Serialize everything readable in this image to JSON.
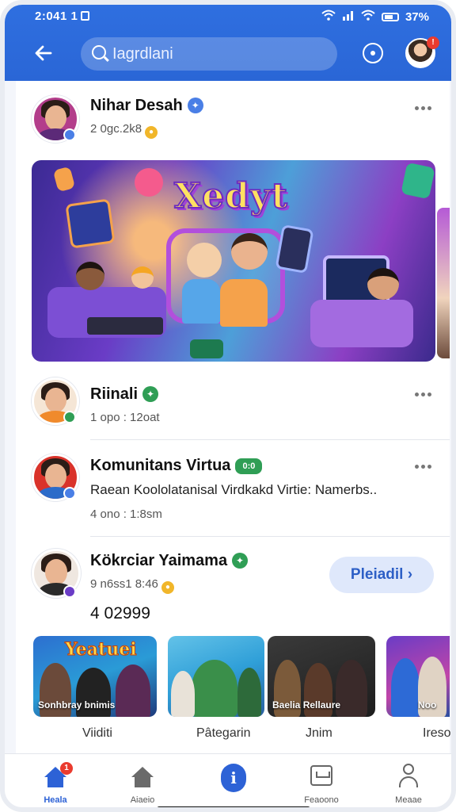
{
  "status_bar": {
    "time": "2:041 1",
    "battery": "37%"
  },
  "header": {
    "search_text": "Iagrdlani",
    "notification_count": "!"
  },
  "posts": [
    {
      "name": "Nihar Desah",
      "meta": "2 0gc.2k8"
    },
    {
      "banner_title": "Xedyt"
    },
    {
      "name": "Riinali",
      "meta": "1 opo : 12oat"
    },
    {
      "name": "Komunitans Virtua",
      "name_badge": "0:0",
      "description": "Raean Koololatanisal Virdkakd Virtie: Namerbs..",
      "meta": "4 ono : 1:8sm"
    },
    {
      "name": "Kökrciar Yaimama",
      "meta": "9 n6ss1 8:46",
      "count": "4 02999",
      "action_label": "Pleiadil"
    }
  ],
  "thumbnails": [
    {
      "overlay_title": "Yeatuei",
      "caption": "Sonhbray bnimis",
      "label": "Viiditi"
    },
    {
      "caption": "",
      "label": "Pâtegarin"
    },
    {
      "caption": "Baelia Rellaure",
      "label": "Jnim"
    },
    {
      "caption": "Noo",
      "label": "Ireso"
    }
  ],
  "tabs": [
    {
      "label": "Heala",
      "icon": "home-icon",
      "badge": "1"
    },
    {
      "label": "Aiaeio",
      "icon": "house-icon"
    },
    {
      "label": "",
      "icon": "info-icon"
    },
    {
      "label": "Feaoono",
      "icon": "inbox-icon"
    },
    {
      "label": "Meaae",
      "icon": "user-icon"
    }
  ],
  "colors": {
    "header_blue": "#2f6fe0",
    "accent_blue": "#2d62d6",
    "verified_blue": "#4a7fe6",
    "verified_green": "#2f9e55",
    "badge_red": "#ea3b2e"
  }
}
